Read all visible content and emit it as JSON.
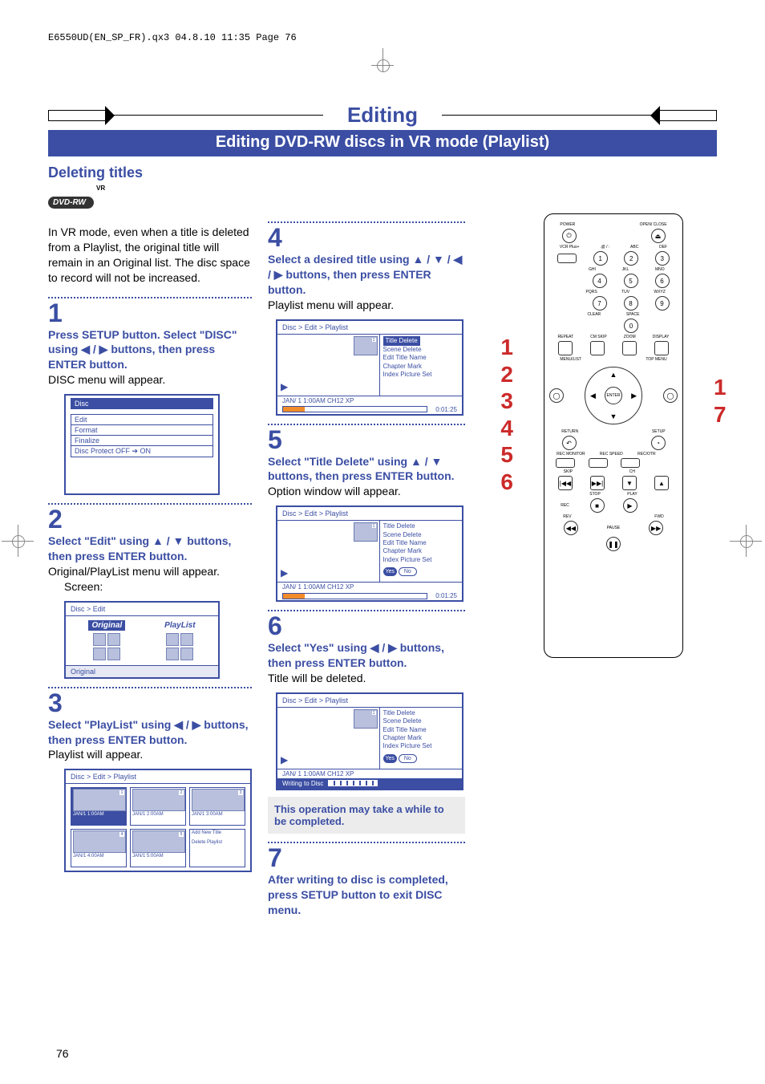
{
  "header": "E6550UD(EN_SP_FR).qx3  04.8.10  11:35  Page 76",
  "pageNumber": "76",
  "title": "Editing",
  "subtitle": "Editing DVD-RW discs in VR mode (Playlist)",
  "sectionHeading": "Deleting titles",
  "vrBadge": {
    "top": "VR",
    "text": "DVD-RW"
  },
  "intro": "In VR mode, even when a title is deleted from a Playlist, the original title will remain in an Original list. The disc space to record will not be increased.",
  "steps": {
    "s1": {
      "num": "1",
      "instr": "Press SETUP button. Select \"DISC\" using ◀ / ▶ buttons, then press ENTER button.",
      "note": "DISC menu will appear."
    },
    "s2": {
      "num": "2",
      "instr": "Select \"Edit\" using ▲ / ▼ buttons, then press ENTER button.",
      "note": "Original/PlayList menu will appear.",
      "screen": "Screen:"
    },
    "s3": {
      "num": "3",
      "instr": "Select \"PlayList\" using ◀ / ▶ buttons, then press ENTER button.",
      "note": "Playlist will appear."
    },
    "s4": {
      "num": "4",
      "instr": "Select a desired title using ▲ / ▼ / ◀ / ▶ buttons, then press ENTER button.",
      "note": "Playlist menu will appear."
    },
    "s5": {
      "num": "5",
      "instr": "Select \"Title Delete\" using ▲ / ▼ buttons, then press ENTER button.",
      "note": "Option window will appear."
    },
    "s6": {
      "num": "6",
      "instr": "Select \"Yes\" using ◀ / ▶ buttons, then press ENTER button.",
      "note": "Title will be deleted."
    },
    "s7": {
      "num": "7",
      "instr": "After writing to disc is completed, press SETUP button to exit DISC menu."
    }
  },
  "noteBox": "This operation may take a while to be completed.",
  "osd": {
    "discMenu": {
      "title": "Disc",
      "items": [
        "Edit",
        "Format",
        "Finalize",
        "Disc Protect OFF ➔ ON"
      ]
    },
    "discEdit": {
      "breadcrumb": "Disc > Edit",
      "original": "Original",
      "playlist": "PlayList",
      "footer": "Original"
    },
    "playlistGrid": {
      "breadcrumb": "Disc > Edit > Playlist",
      "cells": [
        "JAN/1 1:00AM",
        "JAN/1 2:00AM",
        "JAN/1 3:00AM",
        "JAN/1 4:00AM",
        "JAN/1 5:00AM"
      ],
      "addNew": "Add New Title",
      "deletePl": "Delete Playlist",
      "indices": [
        "1",
        "2",
        "3",
        "4",
        "5"
      ]
    },
    "playlistEdit": {
      "breadcrumb": "Disc > Edit > Playlist",
      "menu": [
        "Title Delete",
        "Scene Delete",
        "Edit Title Name",
        "Chapter Mark",
        "Index Picture Set"
      ],
      "status": "JAN/ 1   1:00AM  CH12      XP",
      "duration": "0:01:25",
      "yes": "Yes",
      "no": "No",
      "writing": "Writing to Disc",
      "thumbIdx": "1"
    }
  },
  "remote": {
    "rows": {
      "top1": [
        "POWER",
        "",
        "",
        "OPEN/ CLOSE"
      ],
      "top2": [
        "VCR Plus+",
        ".@ / :",
        "ABC",
        "DEF"
      ],
      "nums": [
        [
          "1",
          "2",
          "3"
        ],
        [
          "4",
          "5",
          "6"
        ],
        [
          "7",
          "8",
          "9"
        ],
        [
          "",
          "0",
          ""
        ]
      ],
      "numLabels2": [
        "",
        "GHI",
        "JKL",
        "MNO"
      ],
      "numLabels3": [
        "",
        "PQRS",
        "TUV",
        "WXYZ"
      ],
      "numLabels4": [
        "",
        "CLEAR",
        "SPACE",
        ""
      ],
      "row4": [
        "REPEAT",
        "CM SKIP",
        "ZOOM",
        "DISPLAY"
      ],
      "row5": [
        "MENU/LIST",
        "",
        "",
        "TOP MENU"
      ],
      "enter": "ENTER",
      "row6": [
        "RETURN",
        "",
        "",
        "SETUP"
      ],
      "row7": [
        "REC MONITOR",
        "REC SPEED",
        "REC/OTR",
        ""
      ],
      "row8a": [
        "SKIP",
        "",
        "CH",
        ""
      ],
      "row8b": [
        "|◀◀",
        "▶▶|",
        "▼",
        "▲"
      ],
      "row9a": [
        "",
        "STOP",
        "PLAY",
        ""
      ],
      "row9b": [
        "REC",
        "■",
        "▶",
        ""
      ],
      "row10a": [
        "REV",
        "",
        "",
        "FWD"
      ],
      "row10b": [
        "◀◀",
        "",
        "",
        "▶▶"
      ],
      "pause": "PAUSE",
      "pauseIcon": "❚❚"
    }
  },
  "callouts": {
    "left": [
      "1",
      "2",
      "3",
      "4",
      "5",
      "6"
    ],
    "right": [
      "1",
      "7"
    ]
  }
}
